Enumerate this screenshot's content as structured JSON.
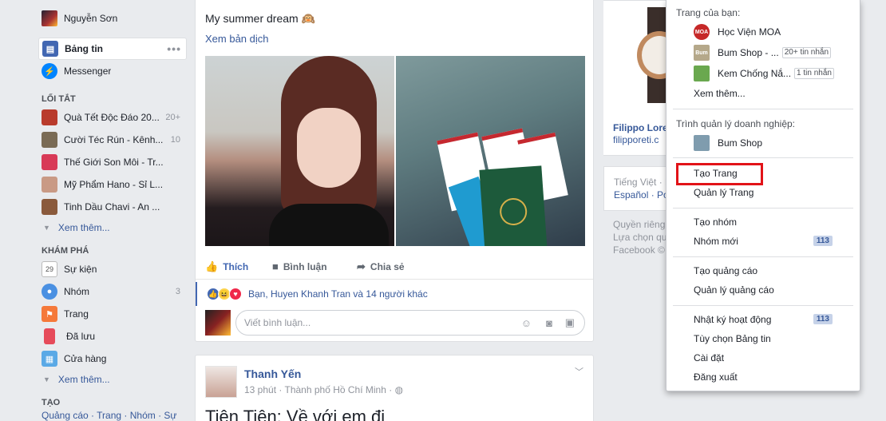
{
  "sidebar": {
    "profile_name": "Nguyễn Sơn",
    "main_items": [
      {
        "label": "Bảng tin",
        "icon": "news-feed-icon"
      },
      {
        "label": "Messenger",
        "icon": "messenger-icon"
      }
    ],
    "shortcuts_title": "LỐI TẮT",
    "shortcuts": [
      {
        "label": "Quà Tết Độc Đáo 20...",
        "count": "20+"
      },
      {
        "label": "Cười Téc Rún - Kênh...",
        "count": "10"
      },
      {
        "label": "Thế Giới Son Môi - Tr...",
        "count": ""
      },
      {
        "label": "Mỹ Phẩm Hano - Sỉ L...",
        "count": ""
      },
      {
        "label": "Tinh Dầu Chavi - An ...",
        "count": ""
      }
    ],
    "see_more_1": "Xem thêm...",
    "explore_title": "KHÁM PHÁ",
    "explore": [
      {
        "label": "Sự kiện",
        "count": "",
        "icon": "calendar-icon",
        "icon_text": "29"
      },
      {
        "label": "Nhóm",
        "count": "3",
        "icon": "groups-icon",
        "icon_text": ""
      },
      {
        "label": "Trang",
        "count": "",
        "icon": "flag-icon",
        "icon_text": ""
      },
      {
        "label": "Đã lưu",
        "count": "",
        "icon": "bookmark-icon",
        "icon_text": ""
      },
      {
        "label": "Cửa hàng",
        "count": "",
        "icon": "shop-icon",
        "icon_text": ""
      }
    ],
    "see_more_2": "Xem thêm...",
    "create_title": "TẠO",
    "create_links": "Quảng cáo · Trang · Nhóm · Sự"
  },
  "post1": {
    "text": "My summer dream 🙉",
    "see_translation": "Xem bản dịch",
    "actions": {
      "like": "Thích",
      "comment": "Bình luận",
      "share": "Chia sẻ"
    },
    "reactions_text": "Bạn, Huyen Khanh Tran và 14 người khác",
    "comment_placeholder": "Viết bình luận..."
  },
  "post2": {
    "author": "Thanh Yến",
    "meta": "13 phút · Thành phố Hồ Chí Minh ·",
    "text": "Tiện Tiện: Về với em đi"
  },
  "right": {
    "ad_title": "Filippo Lore",
    "ad_url": "filipporeti.c",
    "lang_current": "Tiếng Việt · E",
    "lang_links": "Español · Po",
    "footer_1": "Quyền riêng",
    "footer_2": "Lựa chọn qu",
    "footer_3": "Facebook ©"
  },
  "menu": {
    "pages_header": "Trang của bạn:",
    "pages": [
      {
        "label": "Học Viện MOA",
        "badge": "",
        "icon_text": "MOA",
        "color": "#c62828"
      },
      {
        "label": "Bum Shop - ...",
        "badge": "20+ tin nhắn",
        "icon_text": "Bum",
        "color": "#b5a88a"
      },
      {
        "label": "Kem Chống Nắ...",
        "badge": "1 tin nhắn",
        "icon_text": "",
        "color": "#6aa84f"
      }
    ],
    "see_more": "Xem thêm...",
    "business_header": "Trình quản lý doanh nghiệp:",
    "business_item": "Bum Shop",
    "create_page": "Tạo Trang",
    "manage_pages": "Quản lý Trang",
    "create_group": "Tạo nhóm",
    "new_groups": "Nhóm mới",
    "new_groups_count": "113",
    "create_ads": "Tạo quảng cáo",
    "manage_ads": "Quản lý quảng cáo",
    "activity_log": "Nhật ký hoạt động",
    "activity_count": "113",
    "news_feed_prefs": "Tùy chọn Bảng tin",
    "settings": "Cài đặt",
    "logout": "Đăng xuất"
  },
  "colors": {
    "accent": "#365899",
    "highlight": "#e21318",
    "background": "#e9ebee"
  }
}
